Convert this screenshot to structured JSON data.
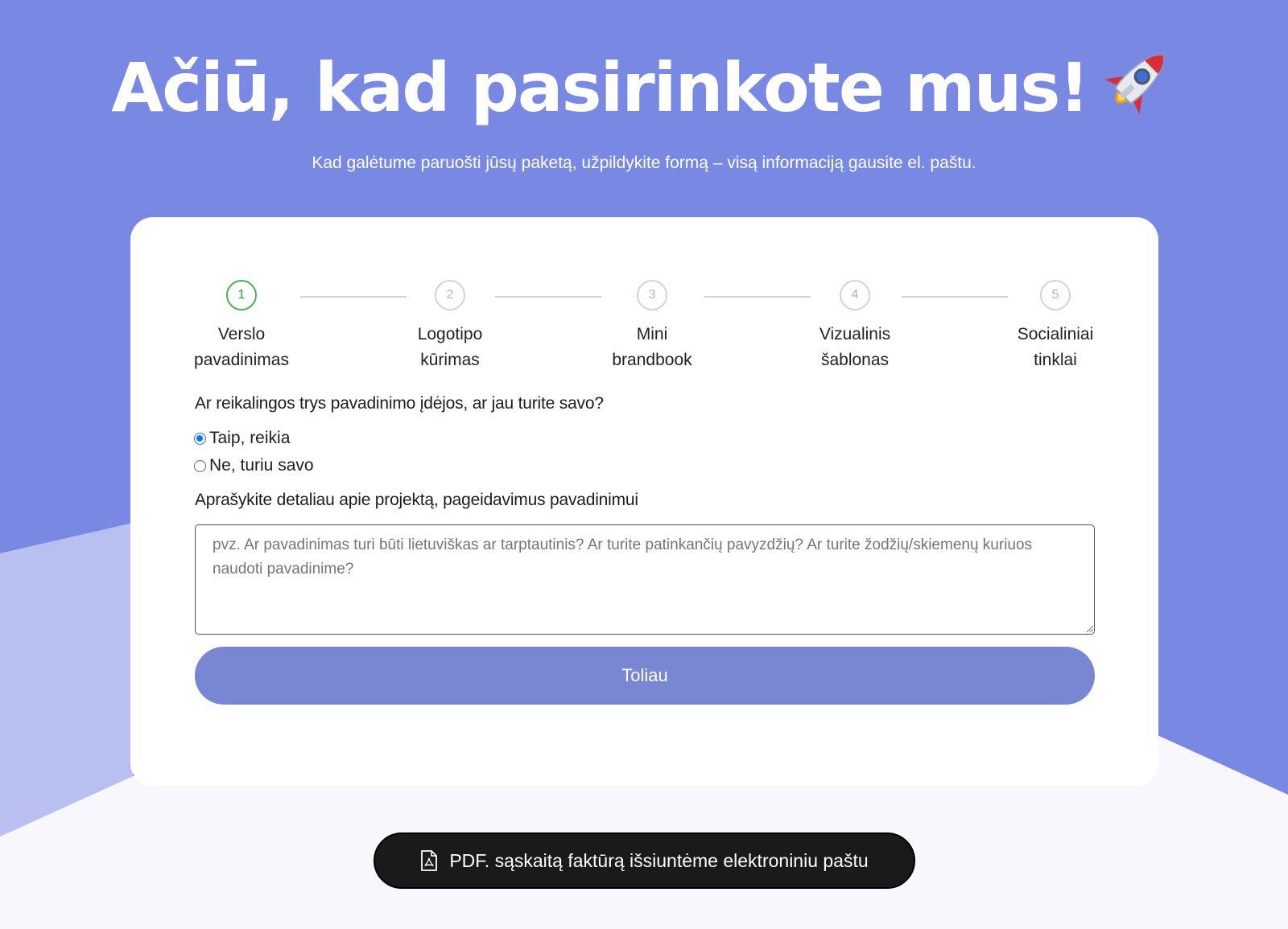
{
  "hero": {
    "title": "Ačiū, kad pasirinkote mus!",
    "title_icon": "rocket-icon",
    "subtitle": "Kad galėtume paruošti jūsų paketą, užpildykite formą – visą informaciją gausite el. paštu."
  },
  "steps": [
    {
      "number": "1",
      "label_line1": "Verslo",
      "label_line2": "pavadinimas",
      "state": "active"
    },
    {
      "number": "2",
      "label_line1": "Logotipo",
      "label_line2": "kūrimas",
      "state": "inactive"
    },
    {
      "number": "3",
      "label_line1": "Mini",
      "label_line2": "brandbook",
      "state": "inactive"
    },
    {
      "number": "4",
      "label_line1": "Vizualinis",
      "label_line2": "šablonas",
      "state": "inactive"
    },
    {
      "number": "5",
      "label_line1": "Socialiniai",
      "label_line2": "tinklai",
      "state": "inactive"
    }
  ],
  "form": {
    "question": "Ar reikalingos trys pavadinimo įdėjos, ar jau turite savo?",
    "options": [
      {
        "label": "Taip, reikia",
        "checked": true
      },
      {
        "label": "Ne, turiu savo",
        "checked": false
      }
    ],
    "description_label": "Aprašykite detaliau apie projektą, pageidavimus pavadinimui",
    "description_placeholder": "pvz. Ar pavadinimas turi būti lietuviškas ar tarptautinis? Ar turite patinkančių pavyzdžių? Ar turite žodžių/skiemenų kuriuos naudoti pavadinime?",
    "description_value": "",
    "next_label": "Toliau"
  },
  "footer": {
    "pdf_icon": "pdf-file-icon",
    "pdf_text": "PDF. sąskaitą faktūrą išsiuntėme elektroniniu paštu"
  },
  "colors": {
    "background": "#7888e3",
    "light_shape": "#b8c0f2",
    "bottom_area": "#f7f7fd",
    "step_active": "#4caf50",
    "button": "#7886d4",
    "pill": "#1a1a1a"
  }
}
